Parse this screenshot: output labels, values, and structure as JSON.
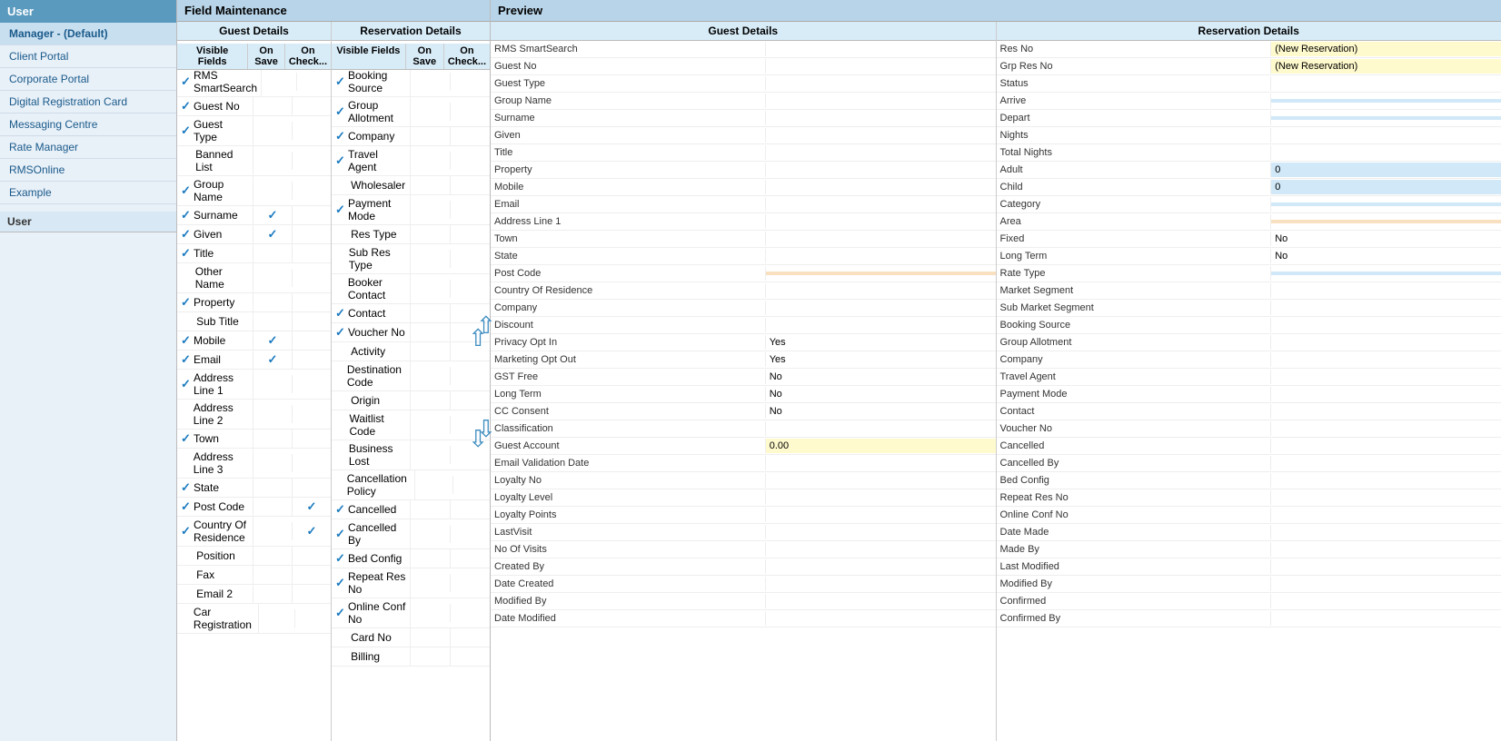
{
  "sidebar": {
    "header": "User",
    "items": [
      {
        "label": "Manager - (Default)",
        "active": true
      },
      {
        "label": "Client Portal"
      },
      {
        "label": "Corporate Portal"
      },
      {
        "label": "Digital Registration Card"
      },
      {
        "label": "Messaging Centre"
      },
      {
        "label": "Rate Manager"
      },
      {
        "label": "RMSOnline"
      },
      {
        "label": "Example"
      }
    ],
    "section": "User"
  },
  "fieldMaintenance": {
    "header": "Field Maintenance",
    "guestDetails": {
      "title": "Guest Details",
      "columns": [
        "Visible Fields",
        "On Save",
        "On Check..."
      ],
      "rows": [
        {
          "label": "RMS SmartSearch",
          "check": true,
          "onSave": false,
          "onCheck": false
        },
        {
          "label": "Guest No",
          "check": true,
          "onSave": false,
          "onCheck": false
        },
        {
          "label": "Guest Type",
          "check": true,
          "onSave": false,
          "onCheck": false
        },
        {
          "label": "Banned List",
          "check": false,
          "onSave": false,
          "onCheck": false
        },
        {
          "label": "Group Name",
          "check": true,
          "onSave": false,
          "onCheck": false
        },
        {
          "label": "Surname",
          "check": true,
          "onSave": true,
          "onCheck": false
        },
        {
          "label": "Given",
          "check": true,
          "onSave": true,
          "onCheck": false
        },
        {
          "label": "Title",
          "check": true,
          "onSave": false,
          "onCheck": false
        },
        {
          "label": "Other Name",
          "check": false,
          "onSave": false,
          "onCheck": false
        },
        {
          "label": "Property",
          "check": true,
          "onSave": false,
          "onCheck": false
        },
        {
          "label": "Sub Title",
          "check": false,
          "onSave": false,
          "onCheck": false
        },
        {
          "label": "Mobile",
          "check": true,
          "onSave": true,
          "onCheck": false
        },
        {
          "label": "Email",
          "check": true,
          "onSave": true,
          "onCheck": false
        },
        {
          "label": "Address Line 1",
          "check": true,
          "onSave": false,
          "onCheck": false
        },
        {
          "label": "Address Line 2",
          "check": false,
          "onSave": false,
          "onCheck": false
        },
        {
          "label": "Town",
          "check": true,
          "onSave": false,
          "onCheck": false
        },
        {
          "label": "Address Line 3",
          "check": false,
          "onSave": false,
          "onCheck": false
        },
        {
          "label": "State",
          "check": true,
          "onSave": false,
          "onCheck": false
        },
        {
          "label": "Post Code",
          "check": true,
          "onSave": false,
          "onCheck": true
        },
        {
          "label": "Country Of Residence",
          "check": true,
          "onSave": false,
          "onCheck": true
        },
        {
          "label": "Position",
          "check": false,
          "onSave": false,
          "onCheck": false
        },
        {
          "label": "Fax",
          "check": false,
          "onSave": false,
          "onCheck": false
        },
        {
          "label": "Email 2",
          "check": false,
          "onSave": false,
          "onCheck": false
        },
        {
          "label": "Car Registration",
          "check": false,
          "onSave": false,
          "onCheck": false
        }
      ]
    },
    "resDetails": {
      "title": "Reservation Details",
      "columns": [
        "Visible Fields",
        "On Save",
        "On Check..."
      ],
      "rows": [
        {
          "label": "Booking Source",
          "check": true,
          "onSave": false,
          "onCheck": false
        },
        {
          "label": "Group Allotment",
          "check": true,
          "onSave": false,
          "onCheck": false
        },
        {
          "label": "Company",
          "check": true,
          "onSave": false,
          "onCheck": false
        },
        {
          "label": "Travel Agent",
          "check": true,
          "onSave": false,
          "onCheck": false
        },
        {
          "label": "Wholesaler",
          "check": false,
          "onSave": false,
          "onCheck": false
        },
        {
          "label": "Payment Mode",
          "check": true,
          "onSave": false,
          "onCheck": false
        },
        {
          "label": "Res Type",
          "check": false,
          "onSave": false,
          "onCheck": false
        },
        {
          "label": "Sub Res Type",
          "check": false,
          "onSave": false,
          "onCheck": false
        },
        {
          "label": "Booker Contact",
          "check": false,
          "onSave": false,
          "onCheck": false
        },
        {
          "label": "Contact",
          "check": true,
          "onSave": false,
          "onCheck": false
        },
        {
          "label": "Voucher No",
          "check": true,
          "onSave": false,
          "onCheck": false
        },
        {
          "label": "Activity",
          "check": false,
          "onSave": false,
          "onCheck": false
        },
        {
          "label": "Destination Code",
          "check": false,
          "onSave": false,
          "onCheck": false
        },
        {
          "label": "Origin",
          "check": false,
          "onSave": false,
          "onCheck": false
        },
        {
          "label": "Waitlist Code",
          "check": false,
          "onSave": false,
          "onCheck": false
        },
        {
          "label": "Business Lost",
          "check": false,
          "onSave": false,
          "onCheck": false
        },
        {
          "label": "Cancellation Policy",
          "check": false,
          "onSave": false,
          "onCheck": false
        },
        {
          "label": "Cancelled",
          "check": true,
          "onSave": false,
          "onCheck": false
        },
        {
          "label": "Cancelled By",
          "check": true,
          "onSave": false,
          "onCheck": false
        },
        {
          "label": "Bed Config",
          "check": true,
          "onSave": false,
          "onCheck": false
        },
        {
          "label": "Repeat Res No",
          "check": true,
          "onSave": false,
          "onCheck": false
        },
        {
          "label": "Online Conf No",
          "check": true,
          "onSave": false,
          "onCheck": false
        },
        {
          "label": "Card No",
          "check": false,
          "onSave": false,
          "onCheck": false
        },
        {
          "label": "Billing",
          "check": false,
          "onSave": false,
          "onCheck": false
        }
      ]
    }
  },
  "preview": {
    "header": "Preview",
    "guestDetails": {
      "title": "Guest Details",
      "rows": [
        {
          "label": "RMS SmartSearch",
          "value": "",
          "style": "white"
        },
        {
          "label": "Guest No",
          "value": "",
          "style": "white"
        },
        {
          "label": "Guest Type",
          "value": "",
          "style": "white"
        },
        {
          "label": "Group Name",
          "value": "",
          "style": "white"
        },
        {
          "label": "Surname",
          "value": "",
          "style": "white"
        },
        {
          "label": "Given",
          "value": "",
          "style": "white"
        },
        {
          "label": "Title",
          "value": "",
          "style": "white"
        },
        {
          "label": "Property",
          "value": "",
          "style": "white"
        },
        {
          "label": "Mobile",
          "value": "",
          "style": "white"
        },
        {
          "label": "Email",
          "value": "",
          "style": "white"
        },
        {
          "label": "Address Line 1",
          "value": "",
          "style": "white"
        },
        {
          "label": "Town",
          "value": "",
          "style": "white"
        },
        {
          "label": "State",
          "value": "",
          "style": "white"
        },
        {
          "label": "Post Code",
          "value": "",
          "style": "orange"
        },
        {
          "label": "Country Of Residence",
          "value": "",
          "style": "white"
        },
        {
          "label": "Company",
          "value": "",
          "style": "white"
        },
        {
          "label": "Discount",
          "value": "",
          "style": "white"
        },
        {
          "label": "Privacy Opt In",
          "value": "Yes",
          "style": "white"
        },
        {
          "label": "Marketing Opt Out",
          "value": "Yes",
          "style": "white"
        },
        {
          "label": "GST Free",
          "value": "No",
          "style": "white"
        },
        {
          "label": "Long Term",
          "value": "No",
          "style": "white"
        },
        {
          "label": "CC Consent",
          "value": "No",
          "style": "white"
        },
        {
          "label": "Classification",
          "value": "",
          "style": "white"
        },
        {
          "label": "Guest Account",
          "value": "0.00",
          "style": "yellow"
        },
        {
          "label": "Email Validation Date",
          "value": "",
          "style": "white"
        },
        {
          "label": "Loyalty No",
          "value": "",
          "style": "white"
        },
        {
          "label": "Loyalty Level",
          "value": "",
          "style": "white"
        },
        {
          "label": "Loyalty Points",
          "value": "",
          "style": "white"
        },
        {
          "label": "LastVisit",
          "value": "",
          "style": "white"
        },
        {
          "label": "No Of Visits",
          "value": "",
          "style": "white"
        },
        {
          "label": "Created By",
          "value": "",
          "style": "white"
        },
        {
          "label": "Date Created",
          "value": "",
          "style": "white"
        },
        {
          "label": "Modified By",
          "value": "",
          "style": "white"
        },
        {
          "label": "Date Modified",
          "value": "",
          "style": "white"
        }
      ]
    },
    "resDetails": {
      "title": "Reservation Details",
      "rows": [
        {
          "label": "Res No",
          "value": "(New Reservation)",
          "style": "yellow"
        },
        {
          "label": "Grp Res No",
          "value": "(New Reservation)",
          "style": "yellow"
        },
        {
          "label": "Status",
          "value": "",
          "style": "white"
        },
        {
          "label": "Arrive",
          "value": "",
          "style": "blue"
        },
        {
          "label": "Depart",
          "value": "",
          "style": "blue"
        },
        {
          "label": "Nights",
          "value": "",
          "style": "white"
        },
        {
          "label": "Total Nights",
          "value": "",
          "style": "white"
        },
        {
          "label": "Adult",
          "value": "0",
          "style": "blue"
        },
        {
          "label": "Child",
          "value": "0",
          "style": "blue"
        },
        {
          "label": "Category",
          "value": "",
          "style": "blue"
        },
        {
          "label": "Area",
          "value": "",
          "style": "orange"
        },
        {
          "label": "Fixed",
          "value": "No",
          "style": "white"
        },
        {
          "label": "Long Term",
          "value": "No",
          "style": "white"
        },
        {
          "label": "Rate Type",
          "value": "",
          "style": "blue"
        },
        {
          "label": "Market Segment",
          "value": "",
          "style": "white"
        },
        {
          "label": "Sub Market Segment",
          "value": "",
          "style": "white"
        },
        {
          "label": "Booking Source",
          "value": "",
          "style": "white"
        },
        {
          "label": "Group Allotment",
          "value": "",
          "style": "white"
        },
        {
          "label": "Company",
          "value": "",
          "style": "white"
        },
        {
          "label": "Travel Agent",
          "value": "",
          "style": "white"
        },
        {
          "label": "Payment Mode",
          "value": "",
          "style": "white"
        },
        {
          "label": "Contact",
          "value": "",
          "style": "white"
        },
        {
          "label": "Voucher No",
          "value": "",
          "style": "white"
        },
        {
          "label": "Cancelled",
          "value": "",
          "style": "white"
        },
        {
          "label": "Cancelled By",
          "value": "",
          "style": "white"
        },
        {
          "label": "Bed Config",
          "value": "",
          "style": "white"
        },
        {
          "label": "Repeat Res No",
          "value": "",
          "style": "white"
        },
        {
          "label": "Online Conf No",
          "value": "",
          "style": "white"
        },
        {
          "label": "Date Made",
          "value": "",
          "style": "white"
        },
        {
          "label": "Made By",
          "value": "",
          "style": "white"
        },
        {
          "label": "Last Modified",
          "value": "",
          "style": "white"
        },
        {
          "label": "Modified By",
          "value": "",
          "style": "white"
        },
        {
          "label": "Confirmed",
          "value": "",
          "style": "white"
        },
        {
          "label": "Confirmed By",
          "value": "",
          "style": "white"
        }
      ]
    }
  }
}
